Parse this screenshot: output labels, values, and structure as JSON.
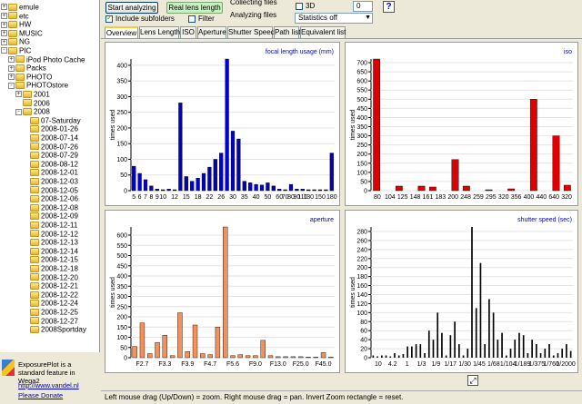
{
  "tree": {
    "items": [
      {
        "label": "emule",
        "depth": 0,
        "exp": "+"
      },
      {
        "label": "etc",
        "depth": 0,
        "exp": "+"
      },
      {
        "label": "HW",
        "depth": 0,
        "exp": "+"
      },
      {
        "label": "MUSIC",
        "depth": 0,
        "exp": "+"
      },
      {
        "label": "NG",
        "depth": 0,
        "exp": "+"
      },
      {
        "label": "PIC",
        "depth": 0,
        "exp": "-"
      },
      {
        "label": "iPod Photo Cache",
        "depth": 1,
        "exp": "+"
      },
      {
        "label": "Packs",
        "depth": 1,
        "exp": "+"
      },
      {
        "label": "PHOTO",
        "depth": 1,
        "exp": "+"
      },
      {
        "label": "PHOTOstore",
        "depth": 1,
        "exp": "-"
      },
      {
        "label": "2001",
        "depth": 2,
        "exp": "+"
      },
      {
        "label": "2006",
        "depth": 2,
        "exp": ""
      },
      {
        "label": "2008",
        "depth": 2,
        "exp": "-"
      },
      {
        "label": "07-Saturday",
        "depth": 3,
        "exp": ""
      },
      {
        "label": "2008-01-26",
        "depth": 3,
        "exp": ""
      },
      {
        "label": "2008-07-14",
        "depth": 3,
        "exp": ""
      },
      {
        "label": "2008-07-26",
        "depth": 3,
        "exp": ""
      },
      {
        "label": "2008-07-29",
        "depth": 3,
        "exp": ""
      },
      {
        "label": "2008-08-12",
        "depth": 3,
        "exp": ""
      },
      {
        "label": "2008-12-01",
        "depth": 3,
        "exp": ""
      },
      {
        "label": "2008-12-03",
        "depth": 3,
        "exp": ""
      },
      {
        "label": "2008-12-05",
        "depth": 3,
        "exp": ""
      },
      {
        "label": "2008-12-06",
        "depth": 3,
        "exp": ""
      },
      {
        "label": "2008-12-08",
        "depth": 3,
        "exp": ""
      },
      {
        "label": "2008-12-09",
        "depth": 3,
        "exp": ""
      },
      {
        "label": "2008-12-11",
        "depth": 3,
        "exp": ""
      },
      {
        "label": "2008-12-12",
        "depth": 3,
        "exp": ""
      },
      {
        "label": "2008-12-13",
        "depth": 3,
        "exp": ""
      },
      {
        "label": "2008-12-14",
        "depth": 3,
        "exp": ""
      },
      {
        "label": "2008-12-15",
        "depth": 3,
        "exp": ""
      },
      {
        "label": "2008-12-18",
        "depth": 3,
        "exp": ""
      },
      {
        "label": "2008-12-20",
        "depth": 3,
        "exp": ""
      },
      {
        "label": "2008-12-21",
        "depth": 3,
        "exp": ""
      },
      {
        "label": "2008-12-22",
        "depth": 3,
        "exp": ""
      },
      {
        "label": "2008-12-24",
        "depth": 3,
        "exp": ""
      },
      {
        "label": "2008-12-25",
        "depth": 3,
        "exp": ""
      },
      {
        "label": "2008-12-27",
        "depth": 3,
        "exp": ""
      },
      {
        "label": "2008Sportday",
        "depth": 3,
        "exp": ""
      }
    ]
  },
  "info": {
    "text": "ExposurePlot is a standard feature in Wega2",
    "link1": "http://www.vandel.nl",
    "link2": "Please Donate"
  },
  "toolbar": {
    "start_label": "Start analyzing",
    "reallens_label": "Real lens length",
    "include_subfolders": "Include subfolders",
    "include_checked": true,
    "filter_label": "Filter",
    "filter_checked": false,
    "status1": "Collecting files",
    "status2": "Analyzing files",
    "threed_label": "3D",
    "threed_checked": false,
    "spin_value": "0",
    "stats_value": "Statistics off",
    "help": "?"
  },
  "tabs": [
    "Overview",
    "Lens Length",
    "ISO",
    "Aperture",
    "Shutter Speed",
    "Path list",
    "Equivalent list"
  ],
  "statusbar": "Left mouse drag (Up/Down) = zoom. Right mouse drag = pan. Invert Zoom rectangle = reset.",
  "colors": {
    "focal": "#0000cc",
    "iso": "#dd0000",
    "aperture": "#f4915a",
    "shutter": "#000000"
  },
  "chart_data": [
    {
      "type": "bar",
      "title": "focal length usage (mm)",
      "ylabel": "times used",
      "ylim": [
        0,
        420
      ],
      "yticks": [
        0,
        50,
        100,
        150,
        200,
        250,
        300,
        350,
        400
      ],
      "ticklabels": [
        "5",
        "6",
        "7",
        "8",
        "9",
        "10",
        "12",
        "15",
        "18",
        "22",
        "26",
        "30",
        "35",
        "40",
        "50",
        "60",
        "70",
        "80",
        "90",
        "110",
        "130",
        "150",
        "180"
      ],
      "tick_at": [
        0,
        1,
        2,
        3,
        4,
        5,
        7,
        9,
        11,
        13,
        15,
        17,
        19,
        21,
        23,
        25,
        26,
        27,
        28,
        29,
        30,
        32,
        34
      ],
      "values": [
        78,
        55,
        35,
        15,
        5,
        3,
        5,
        3,
        280,
        45,
        30,
        40,
        55,
        75,
        100,
        120,
        420,
        190,
        165,
        30,
        25,
        20,
        18,
        25,
        15,
        5,
        3,
        20,
        5,
        5,
        3,
        3,
        3,
        3,
        120
      ]
    },
    {
      "type": "bar",
      "title": "iso",
      "ylabel": "times used",
      "ylim": [
        0,
        720
      ],
      "yticks": [
        0,
        50,
        100,
        150,
        200,
        250,
        300,
        350,
        400,
        450,
        500,
        550,
        600,
        650,
        700
      ],
      "ticklabels": [
        "80",
        "104",
        "125",
        "148",
        "161",
        "183",
        "200",
        "248",
        "259",
        "295",
        "320",
        "356",
        "400",
        "440",
        "640",
        "320"
      ],
      "values": [
        720,
        0,
        25,
        0,
        25,
        20,
        0,
        170,
        25,
        0,
        5,
        0,
        10,
        0,
        500,
        0,
        300,
        30
      ]
    },
    {
      "type": "bar",
      "title": "aperture",
      "ylabel": "times used",
      "ylim": [
        0,
        640
      ],
      "yticks": [
        0,
        50,
        100,
        150,
        200,
        250,
        300,
        350,
        400,
        450,
        500,
        550,
        600
      ],
      "ticklabels": [
        "F2.7",
        "F3.3",
        "F3.9",
        "F4.7",
        "F5.6",
        "F9.0",
        "F13.0",
        "F25.0",
        "F45.0"
      ],
      "values": [
        55,
        170,
        20,
        75,
        110,
        10,
        220,
        30,
        160,
        20,
        15,
        150,
        640,
        10,
        15,
        10,
        10,
        85,
        10,
        5,
        5,
        5,
        5,
        3,
        3,
        25,
        3
      ]
    },
    {
      "type": "bar",
      "title": "shutter speed (sec)",
      "ylabel": "times used",
      "ylim": [
        0,
        290
      ],
      "yticks": [
        0,
        20,
        40,
        60,
        80,
        100,
        120,
        140,
        160,
        180,
        200,
        220,
        240,
        260,
        280
      ],
      "ticklabels": [
        "10",
        "4.2",
        "1",
        "1/3",
        "1/9",
        "1/17",
        "1/30",
        "1/45",
        "1/68",
        "1/104",
        "1/189",
        "1/375",
        "1/760",
        "1/2000"
      ],
      "values": [
        5,
        3,
        5,
        5,
        3,
        10,
        5,
        8,
        25,
        25,
        30,
        30,
        10,
        60,
        40,
        100,
        55,
        5,
        50,
        80,
        30,
        5,
        20,
        290,
        110,
        210,
        30,
        130,
        100,
        40,
        55,
        5,
        20,
        40,
        55,
        50,
        10,
        40,
        30,
        10,
        20,
        30,
        5,
        10,
        20,
        30,
        15
      ]
    }
  ]
}
